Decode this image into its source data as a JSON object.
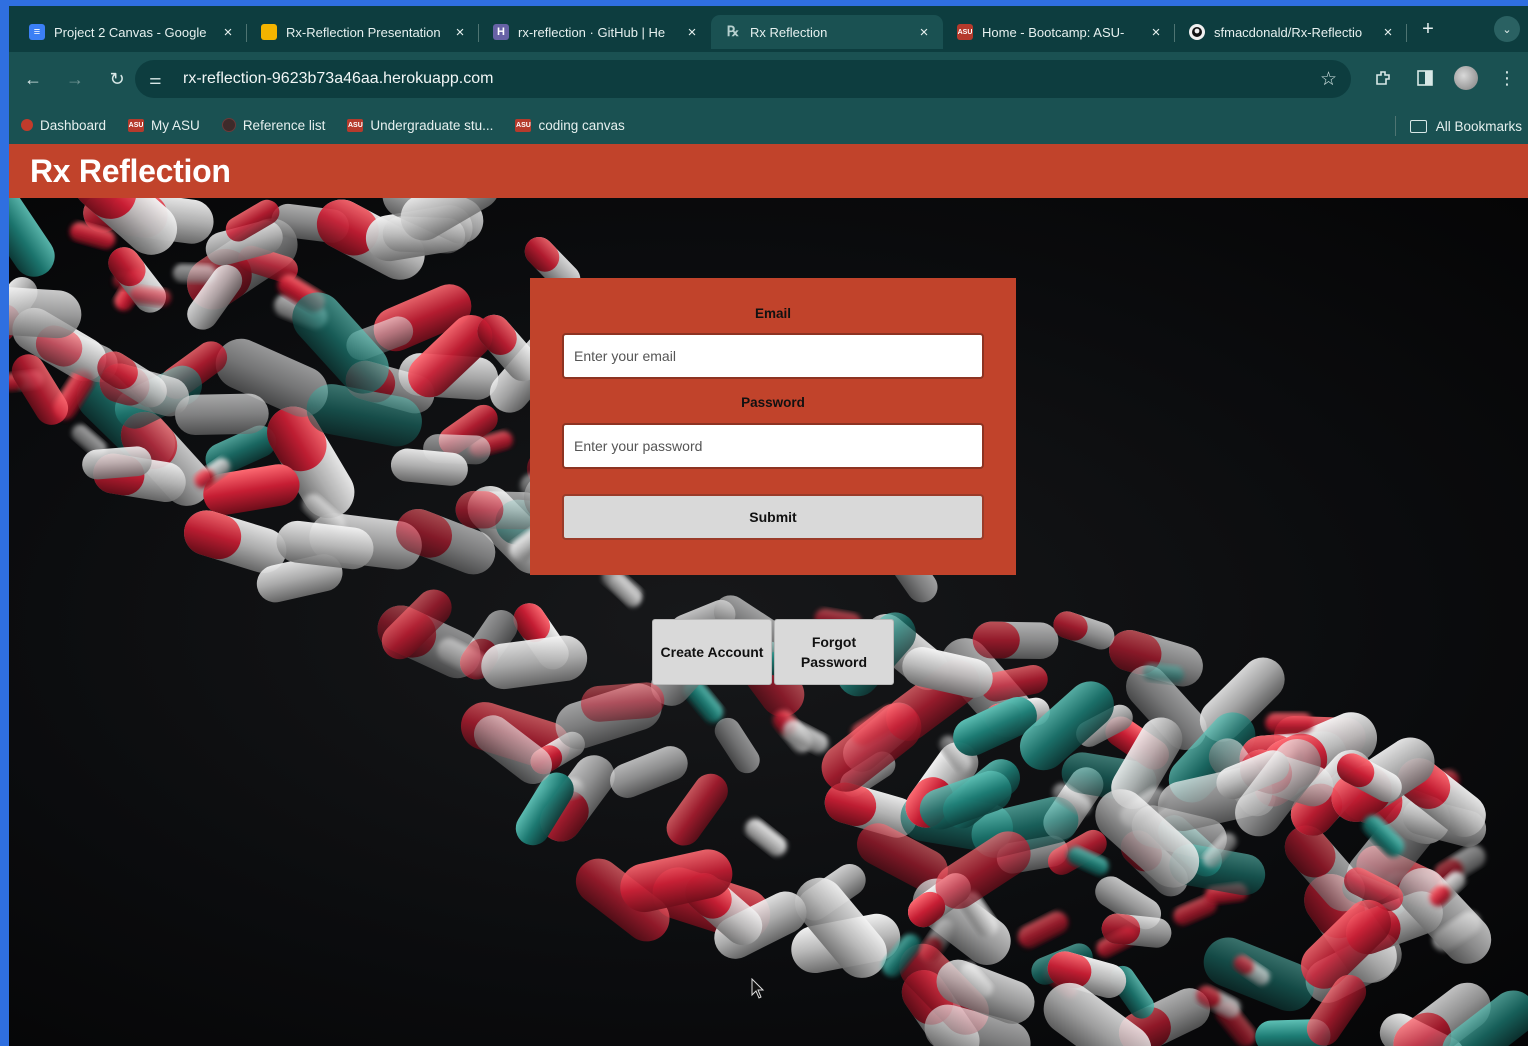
{
  "browser": {
    "tabs": [
      {
        "title": "Project 2 Canvas - Google",
        "favicon": "docs-icon",
        "active": false
      },
      {
        "title": "Rx-Reflection Presentation",
        "favicon": "slides-icon",
        "active": false
      },
      {
        "title": "rx-reflection · GitHub | He",
        "favicon": "heroku-icon",
        "active": false
      },
      {
        "title": "Rx Reflection",
        "favicon": "rx-icon",
        "active": true
      },
      {
        "title": "Home - Bootcamp: ASU-",
        "favicon": "asu-icon",
        "active": false
      },
      {
        "title": "sfmacdonald/Rx-Reflectio",
        "favicon": "github-icon",
        "active": false
      }
    ],
    "new_tab_label": "+",
    "url": "rx-reflection-9623b73a46aa.herokuapp.com",
    "bookmarks": [
      {
        "label": "Dashboard",
        "favicon": "canvas-icon"
      },
      {
        "label": "My ASU",
        "favicon": "asu-icon"
      },
      {
        "label": "Reference list",
        "favicon": "ghost-icon"
      },
      {
        "label": "Undergraduate stu...",
        "favicon": "asu-icon"
      },
      {
        "label": "coding canvas",
        "favicon": "asu-icon"
      }
    ],
    "all_bookmarks_label": "All Bookmarks",
    "theme": {
      "tabstrip": "#0d3d3f",
      "toolbar": "#1a5152"
    }
  },
  "app": {
    "title": "Rx Reflection",
    "brand_color": "#c1432b"
  },
  "login": {
    "email_label": "Email",
    "email_placeholder": "Enter your email",
    "password_label": "Password",
    "password_placeholder": "Enter your password",
    "submit_label": "Submit",
    "create_account_label": "Create Account",
    "forgot_password_label": "Forgot\nPassword"
  }
}
